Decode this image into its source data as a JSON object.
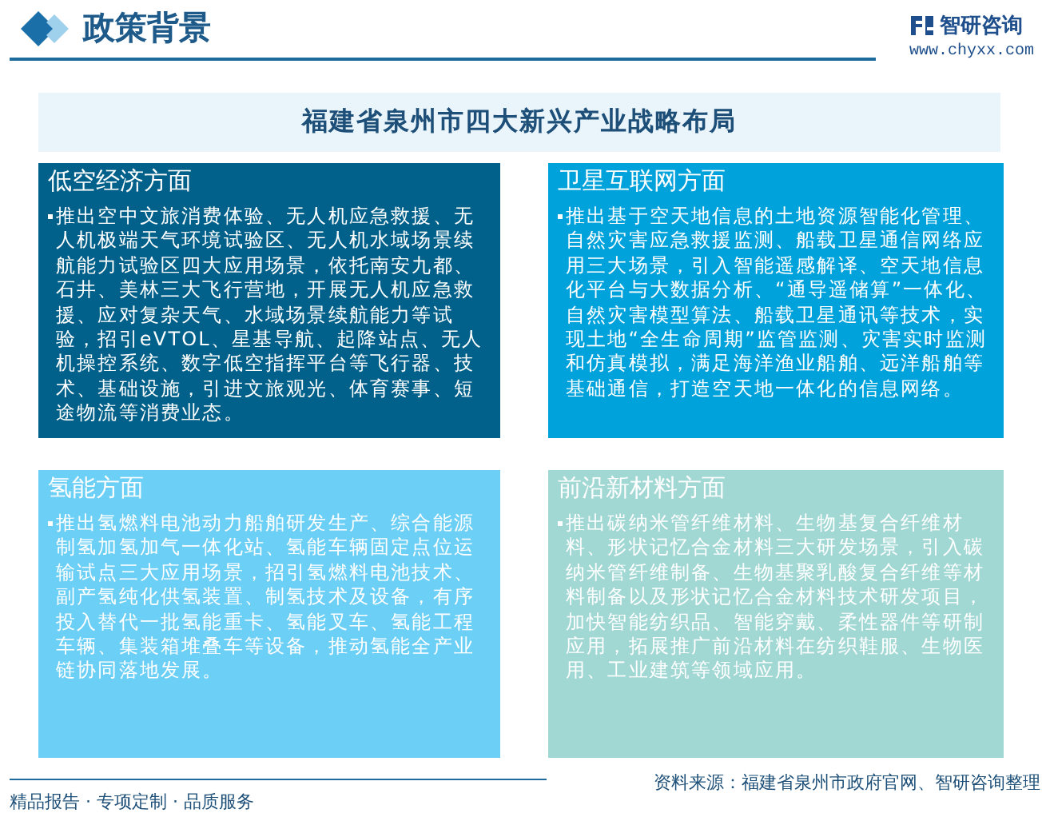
{
  "header": {
    "title": "政策背景",
    "brand": "智研咨询",
    "url": "www.chyxx.com"
  },
  "banner": {
    "title": "福建省泉州市四大新兴产业战略布局"
  },
  "cards": [
    {
      "title": "低空经济方面",
      "color": "#02618a",
      "text": "推出空中文旅消费体验、无人机应急救援、无人机极端天气环境试验区、无人机水域场景续航能力试验区四大应用场景，依托南安九都、石井、美林三大飞行营地，开展无人机应急救援、应对复杂天气、水域场景续航能力等试验，招引eVTOL、星基导航、起降站点、无人机操控系统、数字低空指挥平台等飞行器、技术、基础设施，引进文旅观光、体育赛事、短途物流等消费业态。"
    },
    {
      "title": "卫星互联网方面",
      "color": "#00a2db",
      "text": "推出基于空天地信息的土地资源智能化管理、自然灾害应急救援监测、船载卫星通信网络应用三大场景，引入智能遥感解译、空天地信息化平台与大数据分析、“通导遥储算”一体化、自然灾害模型算法、船载卫星通讯等技术，实现土地“全生命周期”监管监测、灾害实时监测和仿真模拟，满足海洋渔业船舶、远洋船舶等基础通信，打造空天地一体化的信息网络。"
    },
    {
      "title": "氢能方面",
      "color": "#6ccff5",
      "text": "推出氢燃料电池动力船舶研发生产、综合能源制氢加氢加气一体化站、氢能车辆固定点位运输试点三大应用场景，招引氢燃料电池技术、副产氢纯化供氢装置、制氢技术及设备，有序投入替代一批氢能重卡、氢能叉车、氢能工程车辆、集装箱堆叠车等设备，推动氢能全产业链协同落地发展。"
    },
    {
      "title": "前沿新材料方面",
      "color": "#a2d8d4",
      "text": "推出碳纳米管纤维材料、生物基复合纤维材料、形状记忆合金材料三大研发场景，引入碳纳米管纤维制备、生物基聚乳酸复合纤维等材料制备以及形状记忆合金材料技术研发项目，加快智能纺织品、智能穿戴、柔性器件等研制应用，拓展推广前沿材料在纺织鞋服、生物医用、工业建筑等领域应用。"
    }
  ],
  "footer": {
    "slogan": "精品报告 · 专项定制 · 品质服务",
    "source": "资料来源：福建省泉州市政府官网、智研咨询整理"
  }
}
